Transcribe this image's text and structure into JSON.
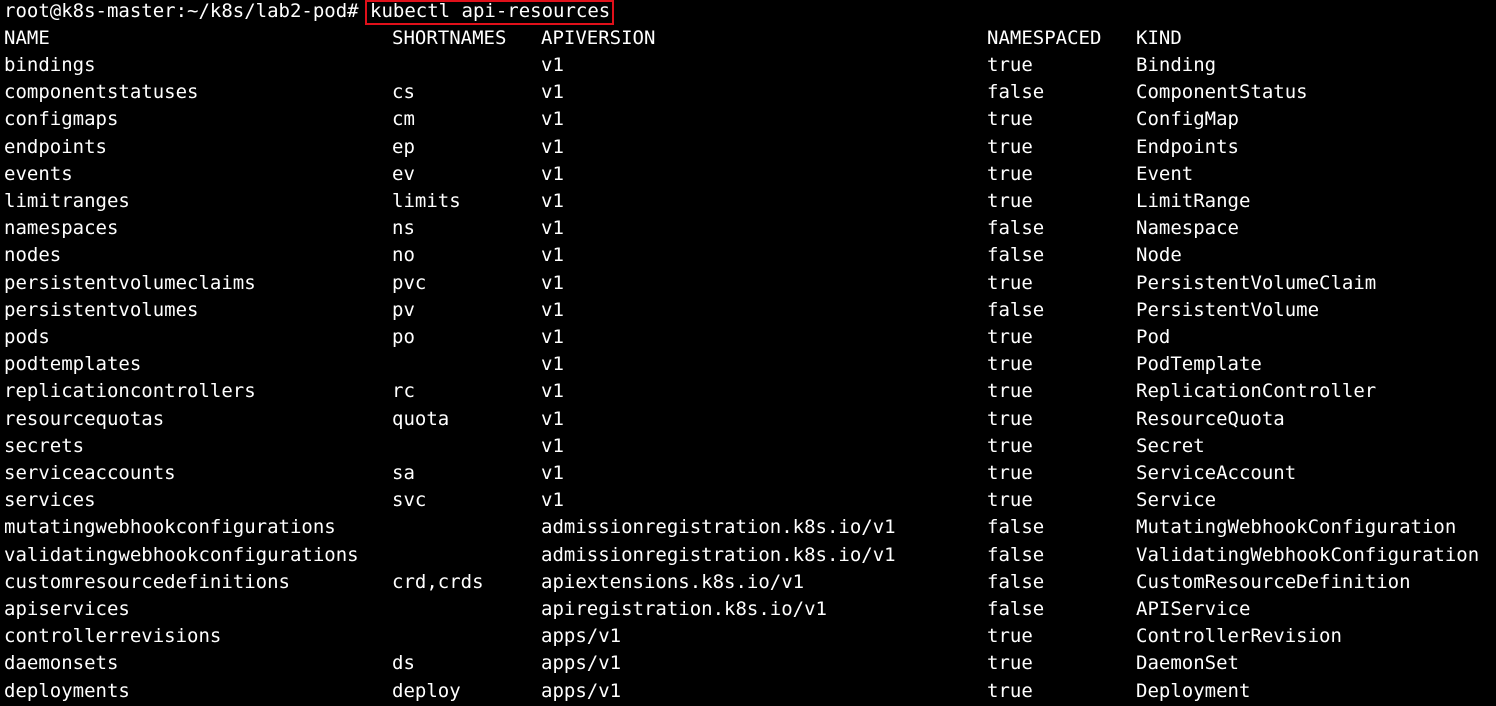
{
  "prompt": "root@k8s-master:~/k8s/lab2-pod#",
  "command": "kubectl api-resources",
  "headers": {
    "name": "NAME",
    "shortnames": "SHORTNAMES",
    "apiversion": "APIVERSION",
    "namespaced": "NAMESPACED",
    "kind": "KIND"
  },
  "rows": [
    {
      "name": "bindings",
      "shortnames": "",
      "apiversion": "v1",
      "namespaced": "true",
      "kind": "Binding"
    },
    {
      "name": "componentstatuses",
      "shortnames": "cs",
      "apiversion": "v1",
      "namespaced": "false",
      "kind": "ComponentStatus"
    },
    {
      "name": "configmaps",
      "shortnames": "cm",
      "apiversion": "v1",
      "namespaced": "true",
      "kind": "ConfigMap"
    },
    {
      "name": "endpoints",
      "shortnames": "ep",
      "apiversion": "v1",
      "namespaced": "true",
      "kind": "Endpoints"
    },
    {
      "name": "events",
      "shortnames": "ev",
      "apiversion": "v1",
      "namespaced": "true",
      "kind": "Event"
    },
    {
      "name": "limitranges",
      "shortnames": "limits",
      "apiversion": "v1",
      "namespaced": "true",
      "kind": "LimitRange"
    },
    {
      "name": "namespaces",
      "shortnames": "ns",
      "apiversion": "v1",
      "namespaced": "false",
      "kind": "Namespace"
    },
    {
      "name": "nodes",
      "shortnames": "no",
      "apiversion": "v1",
      "namespaced": "false",
      "kind": "Node"
    },
    {
      "name": "persistentvolumeclaims",
      "shortnames": "pvc",
      "apiversion": "v1",
      "namespaced": "true",
      "kind": "PersistentVolumeClaim"
    },
    {
      "name": "persistentvolumes",
      "shortnames": "pv",
      "apiversion": "v1",
      "namespaced": "false",
      "kind": "PersistentVolume"
    },
    {
      "name": "pods",
      "shortnames": "po",
      "apiversion": "v1",
      "namespaced": "true",
      "kind": "Pod"
    },
    {
      "name": "podtemplates",
      "shortnames": "",
      "apiversion": "v1",
      "namespaced": "true",
      "kind": "PodTemplate"
    },
    {
      "name": "replicationcontrollers",
      "shortnames": "rc",
      "apiversion": "v1",
      "namespaced": "true",
      "kind": "ReplicationController"
    },
    {
      "name": "resourcequotas",
      "shortnames": "quota",
      "apiversion": "v1",
      "namespaced": "true",
      "kind": "ResourceQuota"
    },
    {
      "name": "secrets",
      "shortnames": "",
      "apiversion": "v1",
      "namespaced": "true",
      "kind": "Secret"
    },
    {
      "name": "serviceaccounts",
      "shortnames": "sa",
      "apiversion": "v1",
      "namespaced": "true",
      "kind": "ServiceAccount"
    },
    {
      "name": "services",
      "shortnames": "svc",
      "apiversion": "v1",
      "namespaced": "true",
      "kind": "Service"
    },
    {
      "name": "mutatingwebhookconfigurations",
      "shortnames": "",
      "apiversion": "admissionregistration.k8s.io/v1",
      "namespaced": "false",
      "kind": "MutatingWebhookConfiguration"
    },
    {
      "name": "validatingwebhookconfigurations",
      "shortnames": "",
      "apiversion": "admissionregistration.k8s.io/v1",
      "namespaced": "false",
      "kind": "ValidatingWebhookConfiguration"
    },
    {
      "name": "customresourcedefinitions",
      "shortnames": "crd,crds",
      "apiversion": "apiextensions.k8s.io/v1",
      "namespaced": "false",
      "kind": "CustomResourceDefinition"
    },
    {
      "name": "apiservices",
      "shortnames": "",
      "apiversion": "apiregistration.k8s.io/v1",
      "namespaced": "false",
      "kind": "APIService"
    },
    {
      "name": "controllerrevisions",
      "shortnames": "",
      "apiversion": "apps/v1",
      "namespaced": "true",
      "kind": "ControllerRevision"
    },
    {
      "name": "daemonsets",
      "shortnames": "ds",
      "apiversion": "apps/v1",
      "namespaced": "true",
      "kind": "DaemonSet"
    },
    {
      "name": "deployments",
      "shortnames": "deploy",
      "apiversion": "apps/v1",
      "namespaced": "true",
      "kind": "Deployment"
    }
  ],
  "colors": {
    "background": "#000000",
    "text": "#ffffff",
    "highlight_border": "#e0101a"
  }
}
